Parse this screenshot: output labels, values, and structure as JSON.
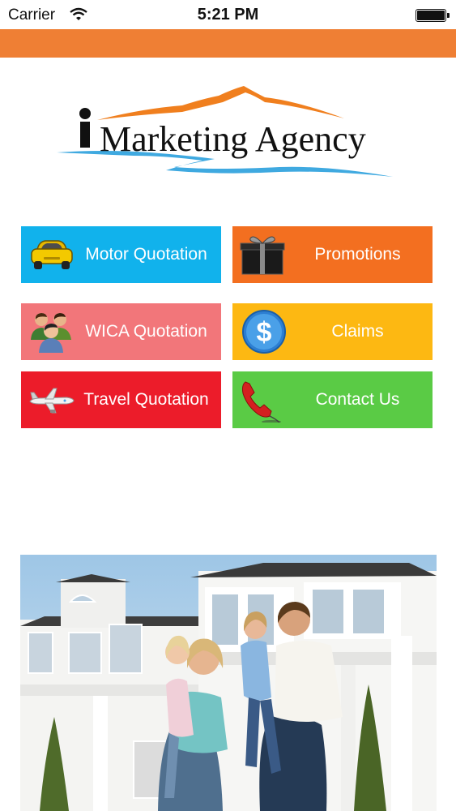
{
  "status_bar": {
    "carrier": "Carrier",
    "time": "5:21 PM"
  },
  "logo": {
    "text": "Marketing Agency"
  },
  "tiles": [
    {
      "label": "Motor Quotation",
      "icon": "car-icon",
      "color": "#11b2ec"
    },
    {
      "label": "Promotions",
      "icon": "gift-box-icon",
      "color": "#f36f20"
    },
    {
      "label": "WICA Quotation",
      "icon": "people-group-icon",
      "color": "#f2767a"
    },
    {
      "label": "Claims",
      "icon": "dollar-coin-icon",
      "color": "#fdb812"
    },
    {
      "label": "Travel Quotation",
      "icon": "airplane-icon",
      "color": "#ec1c2a"
    },
    {
      "label": "Contact Us",
      "icon": "telephone-icon",
      "color": "#5acb45"
    }
  ],
  "colors": {
    "header_bar": "#ef7f34",
    "logo_mountain": "#f07f1e",
    "logo_wave": "#3fa9e0"
  }
}
